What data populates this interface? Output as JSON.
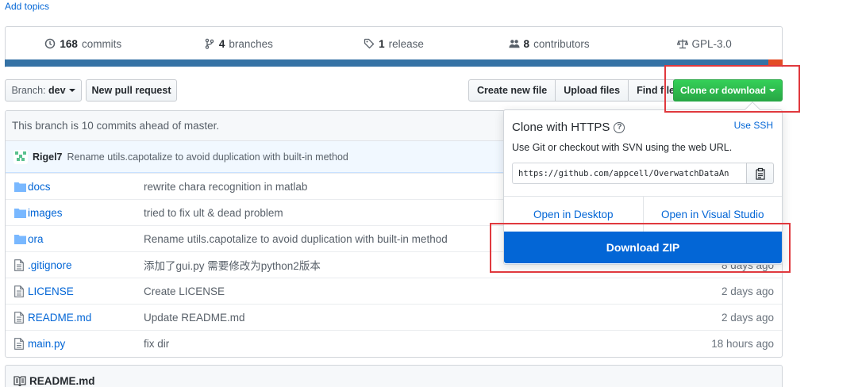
{
  "topics_link": "Add topics",
  "summary": {
    "commits_count": "168",
    "commits_label": "commits",
    "branches_count": "4",
    "branches_label": "branches",
    "releases_count": "1",
    "releases_label": "release",
    "contributors_count": "8",
    "contributors_label": "contributors",
    "license": "GPL-3.0"
  },
  "toolbar": {
    "branch_prefix": "Branch:",
    "branch_name": "dev",
    "new_pull_request": "New pull request",
    "create_new_file": "Create new file",
    "upload_files": "Upload files",
    "find_file": "Find file",
    "clone_or_download": "Clone or download"
  },
  "branch_info": "This branch is 10 commits ahead of master.",
  "latest_commit": {
    "author": "Rigel7",
    "message": "Rename utils.capotalize to avoid duplication with built-in method"
  },
  "files": [
    {
      "name": "docs",
      "type": "folder",
      "message": "rewrite chara recognition in matlab",
      "age": ""
    },
    {
      "name": "images",
      "type": "folder",
      "message": "tried to fix ult & dead problem",
      "age": ""
    },
    {
      "name": "ora",
      "type": "folder",
      "message": "Rename utils.capotalize to avoid duplication with built-in method",
      "age": ""
    },
    {
      "name": ".gitignore",
      "type": "file",
      "message": "添加了gui.py 需要修改为python2版本",
      "age": "8 days ago"
    },
    {
      "name": "LICENSE",
      "type": "file",
      "message": "Create LICENSE",
      "age": "2 days ago"
    },
    {
      "name": "README.md",
      "type": "file",
      "message": "Update README.md",
      "age": "2 days ago"
    },
    {
      "name": "main.py",
      "type": "file",
      "message": "fix dir",
      "age": "18 hours ago"
    }
  ],
  "readme_title": "README.md",
  "clone_popover": {
    "title": "Clone with HTTPS",
    "help_symbol": "?",
    "use_ssh": "Use SSH",
    "description": "Use Git or checkout with SVN using the web URL.",
    "url": "https://github.com/appcell/OverwatchDataAn",
    "open_desktop": "Open in Desktop",
    "open_visual_studio": "Open in Visual Studio",
    "download_zip": "Download ZIP"
  },
  "colors": {
    "accent_blue": "#0366d6",
    "green_button": "#28a745",
    "highlight_red": "#e0393e",
    "language_primary": "#3572a5",
    "language_secondary": "#e34c26"
  }
}
